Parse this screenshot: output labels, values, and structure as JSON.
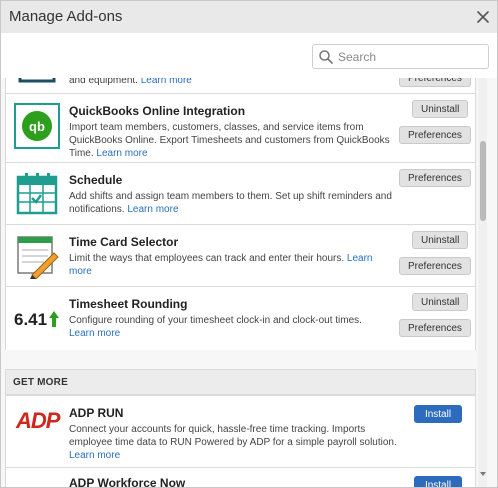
{
  "window": {
    "title": "Manage Add-ons"
  },
  "search": {
    "placeholder": "Search"
  },
  "addons_top_partial": {
    "desc_tail": "and equipment.",
    "learn_more": "Learn more",
    "button": "Preferences"
  },
  "addons": [
    {
      "name": "QuickBooks Online Integration",
      "icon": "quickbooks-logo",
      "description": "Import team members, customers, classes, and service items from QuickBooks Online. Export Timesheets and customers from QuickBooks Time.",
      "learn_more": "Learn more",
      "buttons": [
        "Uninstall",
        "Preferences"
      ]
    },
    {
      "name": "Schedule",
      "icon": "calendar-icon",
      "description": "Add shifts and assign team members to them. Set up shift reminders and notifications.",
      "learn_more": "Learn more",
      "buttons": [
        "Preferences"
      ]
    },
    {
      "name": "Time Card Selector",
      "icon": "notepad-pencil-icon",
      "description": "Limit the ways that employees can track and enter their hours.",
      "learn_more": "Learn more",
      "buttons": [
        "Uninstall",
        "Preferences"
      ]
    },
    {
      "name": "Timesheet Rounding",
      "icon": "rounding-icon",
      "icon_text": "6.41",
      "description": "Configure rounding of your timesheet clock-in and clock-out times.",
      "learn_more": "Learn more",
      "buttons": [
        "Uninstall",
        "Preferences"
      ]
    }
  ],
  "get_more": {
    "heading": "GET MORE",
    "items": [
      {
        "name": "ADP RUN",
        "icon": "adp-logo",
        "icon_text": "ADP",
        "description": "Connect your accounts for quick, hassle-free time tracking. Imports employee time data to RUN Powered by ADP for a simple payroll solution.",
        "learn_more": "Learn more",
        "button": "Install"
      },
      {
        "name": "ADP Workforce Now",
        "button": "Install"
      }
    ]
  },
  "colors": {
    "accent": "#2d6cbd",
    "link": "#2a6fbd",
    "quickbooks": "#2ca01c",
    "teal": "#1f9e8f",
    "adp": "#d0271d"
  }
}
